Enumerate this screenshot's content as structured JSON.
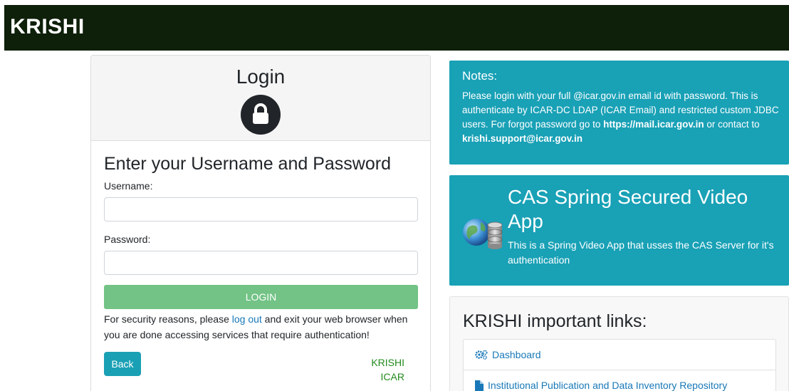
{
  "navbar": {
    "brand": "KRISHI"
  },
  "login": {
    "title": "Login",
    "heading": "Enter your Username and Password",
    "username_label": "Username:",
    "password_label": "Password:",
    "username_value": "",
    "password_value": "",
    "login_button": "LOGIN",
    "security_pre": "For security reasons, please ",
    "security_link": "log out",
    "security_post": " and exit your web browser when you are done accessing services that require authentication!",
    "back_button": "Back",
    "footer_line1": "KRISHI",
    "footer_line2": "ICAR"
  },
  "notes": {
    "title": "Notes:",
    "text_1": "Please login with your full @icar.gov.in email id with password. This is authenticate by ICAR-DC LDAP (ICAR Email) and restricted custom JDBC users. For forgot password go to ",
    "link_1": "https://mail.icar.gov.in",
    "text_2": " or contact to ",
    "link_2": "krishi.support@icar.gov.in"
  },
  "cas": {
    "title": "CAS Spring Secured Video App",
    "text": "This is a Spring Video App that usses the CAS Server for it's authentication"
  },
  "links": {
    "title": "KRISHI important links:",
    "items": [
      {
        "label": "Dashboard",
        "icon": "gears-icon"
      },
      {
        "label": "Institutional Publication and Data Inventory Repository",
        "icon": "file-icon"
      }
    ]
  },
  "colors": {
    "navbar_bg": "#0e1f0a",
    "info_bg": "#19a1b6",
    "login_button_bg": "#72c385",
    "link": "#1878b8",
    "footer_brand": "#218a1b"
  }
}
